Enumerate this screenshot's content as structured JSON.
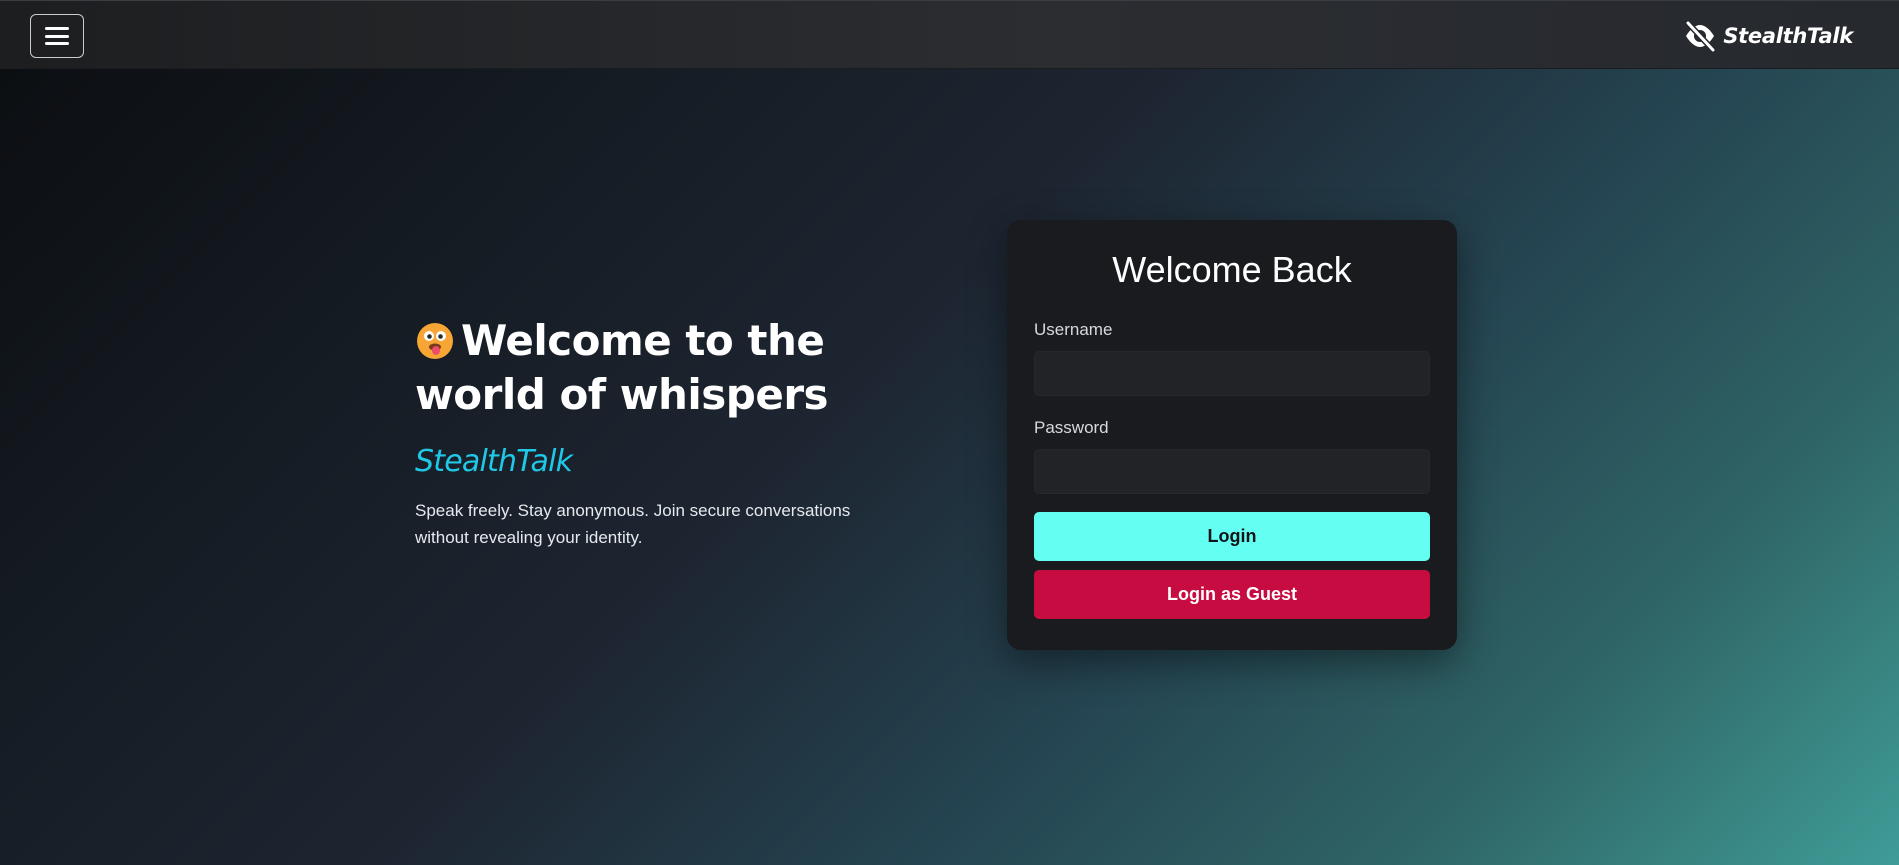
{
  "navbar": {
    "menu_icon": "hamburger-icon",
    "brand_icon": "eye-slash-icon",
    "brand_name": "StealthTalk"
  },
  "hero": {
    "emoji_icon": "face-with-tongue-icon",
    "title": "Welcome to the world of whispers",
    "brand_name": "StealthTalk",
    "description": "Speak freely. Stay anonymous. Join secure conversations without revealing your identity."
  },
  "login": {
    "title": "Welcome Back",
    "username_label": "Username",
    "username_value": "",
    "password_label": "Password",
    "password_value": "",
    "login_button": "Login",
    "guest_button": "Login as Guest"
  },
  "colors": {
    "accent_cyan": "#63fff2",
    "brand_blue": "#1ec8e6",
    "guest_red": "#c60c40",
    "card_bg": "#191b1e"
  }
}
